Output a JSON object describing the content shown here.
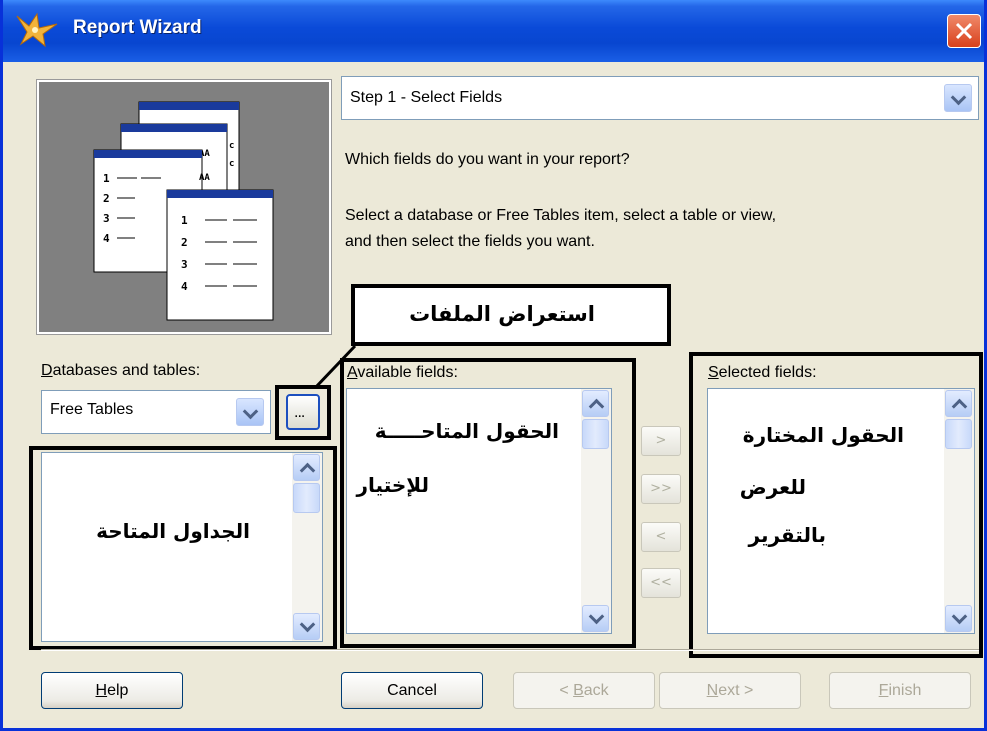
{
  "window": {
    "title": "Report Wizard"
  },
  "step_selector": {
    "value": "Step 1 - Select Fields"
  },
  "instructions": {
    "question": "Which fields do you want in your report?",
    "detail_line1": "Select a database or Free Tables item, select a table or view,",
    "detail_line2": "and then select the fields you want."
  },
  "preview_table_rows": [
    "1",
    "2",
    "3",
    "4"
  ],
  "databases": {
    "label_underlined": "D",
    "label_rest": "atabases and tables:",
    "selected_value": "Free Tables",
    "browse_label": "...",
    "annotation": "الجداول المتاحة"
  },
  "browse_annotation": "استعراض الملفات",
  "available_fields": {
    "label_underlined": "A",
    "label_rest": "vailable fields:",
    "annotation_line1": "الحقول المتاحـــــة",
    "annotation_line2": "للإختيار"
  },
  "selected_fields": {
    "label_underlined": "S",
    "label_rest": "elected fields:",
    "annotation_line1": "الحقول المختارة",
    "annotation_line2": "للعرض",
    "annotation_line3": "بالتقرير"
  },
  "movers": [
    ">",
    ">>",
    "<",
    "<<"
  ],
  "buttons": {
    "help_u": "H",
    "help_rest": "elp",
    "cancel": "Cancel",
    "back_prefix": "< ",
    "back_u": "B",
    "back_rest": "ack",
    "next_u": "N",
    "next_rest": "ext >",
    "finish_u": "F",
    "finish_rest": "inish"
  }
}
